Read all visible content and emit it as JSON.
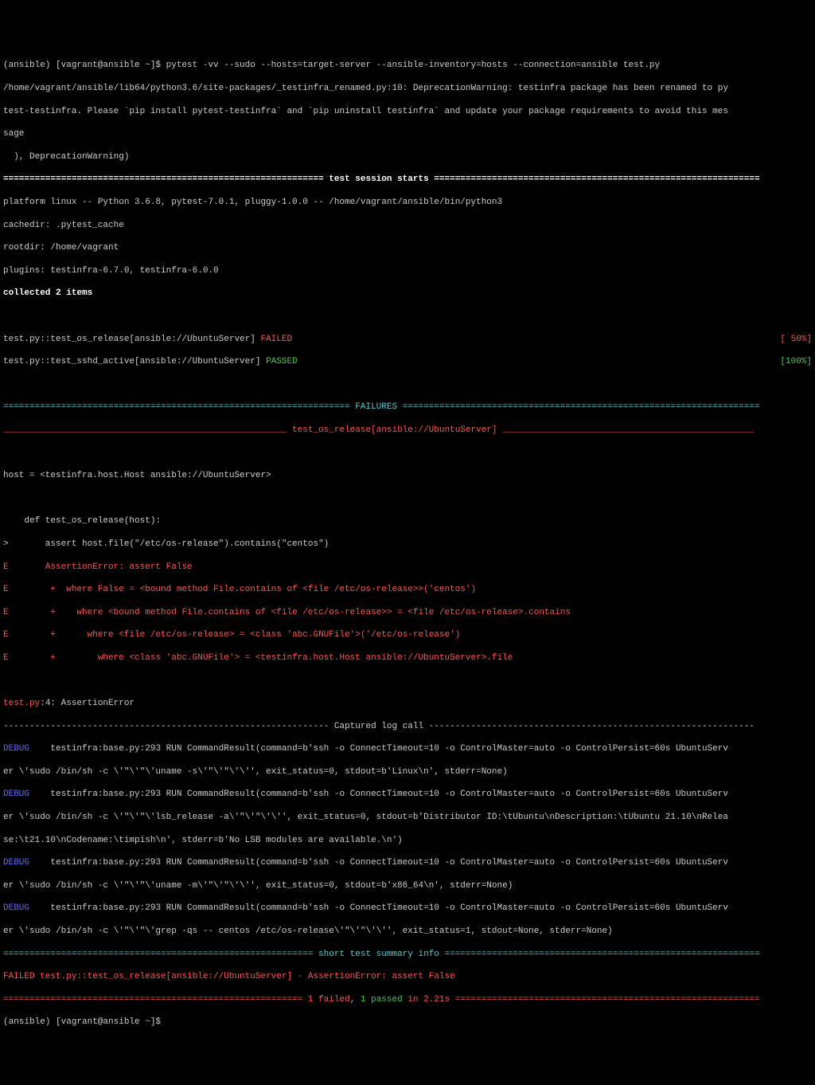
{
  "prompt_line": "(ansible) [vagrant@ansible ~]$ pytest -vv --sudo --hosts=target-server --ansible-inventory=hosts --connection=ansible test.py",
  "deprecation_1": "/home/vagrant/ansible/lib64/python3.6/site-packages/_testinfra_renamed.py:10: DeprecationWarning: testinfra package has been renamed to py",
  "deprecation_2": "test-testinfra. Please `pip install pytest-testinfra` and `pip uninstall testinfra` and update your package requirements to avoid this mes",
  "deprecation_3": "sage",
  "deprecation_4": "  ), DeprecationWarning)",
  "session_rule": "============================================================= test session starts ==============================================================",
  "platform": "platform linux -- Python 3.6.8, pytest-7.0.1, pluggy-1.0.0 -- /home/vagrant/ansible/bin/python3",
  "cachedir": "cachedir: .pytest_cache",
  "rootdir": "rootdir: /home/vagrant",
  "plugins": "plugins: testinfra-6.7.0, testinfra-6.0.0",
  "collected": "collected 2 items",
  "test1": {
    "name": "test.py::test_os_release[ansible://UbuntuServer] ",
    "status": "FAILED",
    "pct": "[ 50%]"
  },
  "test2": {
    "name": "test.py::test_sshd_active[ansible://UbuntuServer] ",
    "status": "PASSED",
    "pct": "[100%]"
  },
  "failures_rule": "================================================================== FAILURES ====================================================================",
  "failure_name_rule": "______________________________________________________ test_os_release[ansible://UbuntuServer] ________________________________________________",
  "host_line": "host = <testinfra.host.Host ansible://UbuntuServer>",
  "def_line": "    def test_os_release(host):",
  "assert_line": ">       assert host.file(\"/etc/os-release\").contains(\"centos\")",
  "e1": {
    "prefix": "E       ",
    "text": "AssertionError: assert False"
  },
  "e2": {
    "prefix": "E        +  ",
    "text": "where False = <bound method File.contains of <file /etc/os-release>>('centos')"
  },
  "e3": {
    "prefix": "E        +    ",
    "text": "where <bound method File.contains of <file /etc/os-release>> = <file /etc/os-release>.contains"
  },
  "e4": {
    "prefix": "E        +      ",
    "text": "where <file /etc/os-release> = <class 'abc.GNUFile'>('/etc/os-release')"
  },
  "e5": {
    "prefix": "E        +        ",
    "text": "where <class 'abc.GNUFile'> = <testinfra.host.Host ansible://UbuntuServer>.file"
  },
  "assertion_loc": {
    "file": "test.py",
    "rest": ":4: AssertionError"
  },
  "captured_rule": "-------------------------------------------------------------- Captured log call --------------------------------------------------------------",
  "debug1": {
    "tag": "DEBUG",
    "l1": "    testinfra:base.py:293 RUN CommandResult(command=b'ssh -o ConnectTimeout=10 -o ControlMaster=auto -o ControlPersist=60s UbuntuServ",
    "l2": "er \\'sudo /bin/sh -c \\'\"\\'\"\\'uname -s\\'\"\\'\"\\'\\'', exit_status=0, stdout=b'Linux\\n', stderr=None)"
  },
  "debug2": {
    "tag": "DEBUG",
    "l1": "    testinfra:base.py:293 RUN CommandResult(command=b'ssh -o ConnectTimeout=10 -o ControlMaster=auto -o ControlPersist=60s UbuntuServ",
    "l2": "er \\'sudo /bin/sh -c \\'\"\\'\"\\'lsb_release -a\\'\"\\'\"\\'\\'', exit_status=0, stdout=b'Distributor ID:\\tUbuntu\\nDescription:\\tUbuntu 21.10\\nRelea",
    "l3": "se:\\t21.10\\nCodename:\\timpish\\n', stderr=b'No LSB modules are available.\\n')"
  },
  "debug3": {
    "tag": "DEBUG",
    "l1": "    testinfra:base.py:293 RUN CommandResult(command=b'ssh -o ConnectTimeout=10 -o ControlMaster=auto -o ControlPersist=60s UbuntuServ",
    "l2": "er \\'sudo /bin/sh -c \\'\"\\'\"\\'uname -m\\'\"\\'\"\\'\\'', exit_status=0, stdout=b'x86_64\\n', stderr=None)"
  },
  "debug4": {
    "tag": "DEBUG",
    "l1": "    testinfra:base.py:293 RUN CommandResult(command=b'ssh -o ConnectTimeout=10 -o ControlMaster=auto -o ControlPersist=60s UbuntuServ",
    "l2": "er \\'sudo /bin/sh -c \\'\"\\'\"\\'grep -qs -- centos /etc/os-release\\'\"\\'\"\\'\\'', exit_status=1, stdout=None, stderr=None)"
  },
  "short_summary_rule": "=========================================================== short test summary info ============================================================",
  "failed_summary": "FAILED test.py::test_os_release[ansible://UbuntuServer] - AssertionError: assert False",
  "final_rule": {
    "left": "========================================================= ",
    "failed": "1 failed",
    "comma": ", ",
    "passed": "1 passed",
    "time": " in 2.21s",
    "right": " =========================================================="
  },
  "prompt_end": "(ansible) [vagrant@ansible ~]$"
}
